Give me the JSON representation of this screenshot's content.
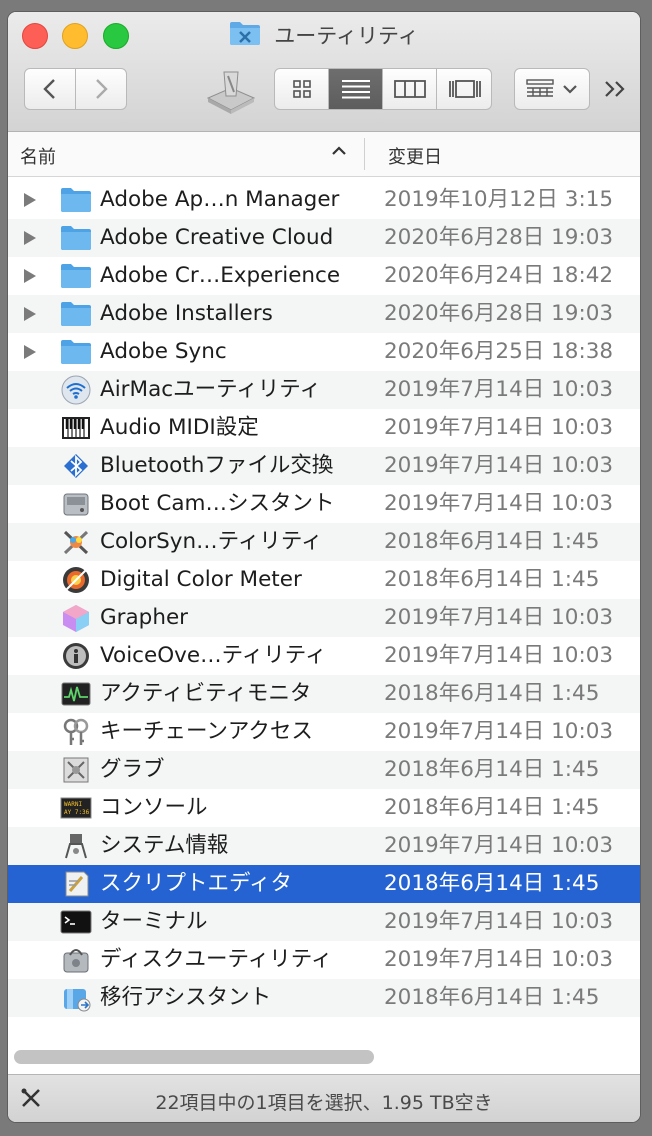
{
  "window": {
    "title": "ユーティリティ"
  },
  "columns": {
    "name": "名前",
    "date": "変更日"
  },
  "items": [
    {
      "name": "Adobe Ap…n Manager",
      "date": "2019年10月12日 3:15",
      "icon": "folder-icon",
      "expandable": true
    },
    {
      "name": "Adobe Creative Cloud",
      "date": "2020年6月28日 19:03",
      "icon": "folder-icon",
      "expandable": true
    },
    {
      "name": "Adobe Cr…Experience",
      "date": "2020年6月24日 18:42",
      "icon": "folder-icon",
      "expandable": true
    },
    {
      "name": "Adobe Installers",
      "date": "2020年6月28日 19:03",
      "icon": "folder-icon",
      "expandable": true
    },
    {
      "name": "Adobe Sync",
      "date": "2020年6月25日 18:38",
      "icon": "folder-icon",
      "expandable": true
    },
    {
      "name": "AirMacユーティリティ",
      "date": "2019年7月14日 10:03",
      "icon": "wifi-icon",
      "expandable": false
    },
    {
      "name": "Audio MIDI設定",
      "date": "2019年7月14日 10:03",
      "icon": "keyboard-icon",
      "expandable": false
    },
    {
      "name": "Bluetoothファイル交換",
      "date": "2019年7月14日 10:03",
      "icon": "bluetooth-icon",
      "expandable": false
    },
    {
      "name": "Boot Cam…シスタント",
      "date": "2019年7月14日 10:03",
      "icon": "disk-icon",
      "expandable": false
    },
    {
      "name": "ColorSyn…ティリティ",
      "date": "2018年6月14日 1:45",
      "icon": "colorsync-icon",
      "expandable": false
    },
    {
      "name": "Digital Color Meter",
      "date": "2018年6月14日 1:45",
      "icon": "color-meter-icon",
      "expandable": false
    },
    {
      "name": "Grapher",
      "date": "2019年7月14日 10:03",
      "icon": "grapher-icon",
      "expandable": false
    },
    {
      "name": "VoiceOve…ティリティ",
      "date": "2019年7月14日 10:03",
      "icon": "voiceover-icon",
      "expandable": false
    },
    {
      "name": "アクティビティモニタ",
      "date": "2018年6月14日 1:45",
      "icon": "activity-monitor-icon",
      "expandable": false
    },
    {
      "name": "キーチェーンアクセス",
      "date": "2019年7月14日 10:03",
      "icon": "keychain-icon",
      "expandable": false
    },
    {
      "name": "グラブ",
      "date": "2018年6月14日 1:45",
      "icon": "grab-icon",
      "expandable": false
    },
    {
      "name": "コンソール",
      "date": "2018年6月14日 1:45",
      "icon": "console-icon",
      "expandable": false
    },
    {
      "name": "システム情報",
      "date": "2019年7月14日 10:03",
      "icon": "system-info-icon",
      "expandable": false
    },
    {
      "name": "スクリプトエディタ",
      "date": "2018年6月14日 1:45",
      "icon": "script-editor-icon",
      "expandable": false,
      "selected": true
    },
    {
      "name": "ターミナル",
      "date": "2019年7月14日 10:03",
      "icon": "terminal-icon",
      "expandable": false
    },
    {
      "name": "ディスクユーティリティ",
      "date": "2019年7月14日 10:03",
      "icon": "disk-utility-icon",
      "expandable": false
    },
    {
      "name": "移行アシスタント",
      "date": "2018年6月14日 1:45",
      "icon": "migration-icon",
      "expandable": false
    }
  ],
  "status": {
    "text": "22項目中の1項目を選択、1.95 TB空き"
  },
  "colors": {
    "selection": "#2463d1",
    "folder": "#6cb8ef"
  }
}
